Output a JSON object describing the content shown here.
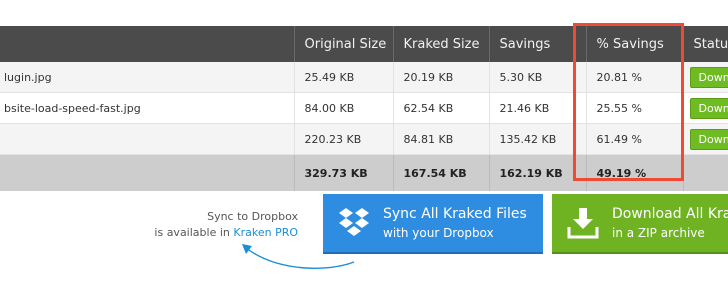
{
  "table": {
    "headers": [
      "",
      "Original Size",
      "Kraked Size",
      "Savings",
      "% Savings",
      "Status"
    ],
    "rows": [
      {
        "file": "lugin.jpg",
        "original": "25.49 KB",
        "kraked": "20.19 KB",
        "savings": "5.30 KB",
        "percent": "20.81 %",
        "status": "Down"
      },
      {
        "file": "bsite-load-speed-fast.jpg",
        "original": "84.00 KB",
        "kraked": "62.54 KB",
        "savings": "21.46 KB",
        "percent": "25.55 %",
        "status": "Down"
      },
      {
        "file": "",
        "original": "220.23 KB",
        "kraked": "84.81 KB",
        "savings": "135.42 KB",
        "percent": "61.49 %",
        "status": "Down"
      }
    ],
    "totals": {
      "original": "329.73 KB",
      "kraked": "167.54 KB",
      "savings": "162.19 KB",
      "percent": "49.19 %"
    }
  },
  "promo": {
    "line1": "Sync to Dropbox",
    "line2_prefix": "is available in",
    "line2_link": "Kraken PRO"
  },
  "buttons": {
    "dropbox": {
      "line1": "Sync All Kraked Files",
      "line2": "with your Dropbox",
      "icon": "dropbox-icon"
    },
    "zip": {
      "line1": "Download All Kra",
      "line2": "in a ZIP archive",
      "icon": "download-icon"
    }
  },
  "colors": {
    "header_bg": "#4b4b4b",
    "highlight": "#f04a32",
    "dropbox_blue": "#2e8de0",
    "zip_green": "#6fb323",
    "status_green": "#6fbb22",
    "link_blue": "#1a8fd6"
  }
}
